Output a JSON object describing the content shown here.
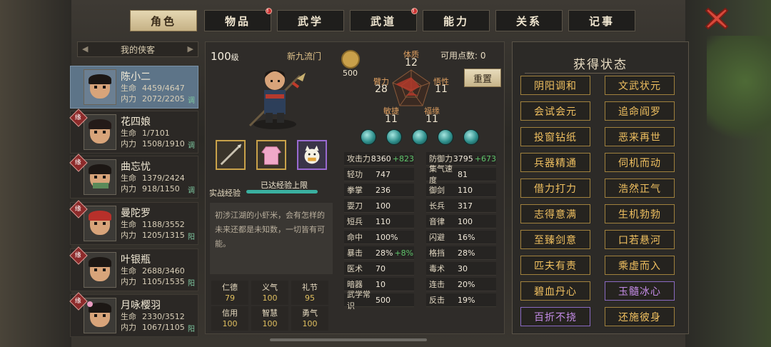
{
  "tabs": [
    {
      "label": "角色",
      "active": true,
      "dot": false
    },
    {
      "label": "物品",
      "active": false,
      "dot": true
    },
    {
      "label": "武学",
      "active": false,
      "dot": false
    },
    {
      "label": "武道",
      "active": false,
      "dot": true
    },
    {
      "label": "能力",
      "active": false,
      "dot": false
    },
    {
      "label": "关系",
      "active": false,
      "dot": false
    },
    {
      "label": "记事",
      "active": false,
      "dot": false
    }
  ],
  "list": {
    "title": "我的侠客"
  },
  "heroes": [
    {
      "name": "陈小二",
      "hp_label": "生命",
      "hp": "4459/4647",
      "mp_label": "内力",
      "mp": "2072/2205",
      "tag": "调",
      "badge": ""
    },
    {
      "name": "花四娘",
      "hp_label": "生命",
      "hp": "1/7101",
      "mp_label": "内力",
      "mp": "1508/1910",
      "tag": "调",
      "badge": "缘"
    },
    {
      "name": "曲忘忧",
      "hp_label": "生命",
      "hp": "1379/2424",
      "mp_label": "内力",
      "mp": "918/1150",
      "tag": "调",
      "badge": "缘"
    },
    {
      "name": "曼陀罗",
      "hp_label": "生命",
      "hp": "1188/3552",
      "mp_label": "内力",
      "mp": "1205/1315",
      "tag": "阳",
      "badge": "缘"
    },
    {
      "name": "叶银瓶",
      "hp_label": "生命",
      "hp": "2688/3460",
      "mp_label": "内力",
      "mp": "1105/1535",
      "tag": "阳",
      "badge": "缘"
    },
    {
      "name": "月咏樱羽",
      "hp_label": "生命",
      "hp": "2330/3512",
      "mp_label": "内力",
      "mp": "1067/1105",
      "tag": "阳",
      "badge": "缘"
    }
  ],
  "char": {
    "level": "100",
    "level_unit": "级",
    "sect": "新九流门",
    "xp_label": "实战经验",
    "xp_status": "已达经验上限",
    "xp_fraction": 1.0,
    "desc": "初涉江湖的小虾米，会有怎样的未来还都是未知数，一切皆有可能。",
    "virtues": [
      {
        "n": "仁德",
        "v": "79"
      },
      {
        "n": "义气",
        "v": "100"
      },
      {
        "n": "礼节",
        "v": "95"
      },
      {
        "n": "信用",
        "v": "100"
      },
      {
        "n": "智慧",
        "v": "100"
      },
      {
        "n": "勇气",
        "v": "100"
      }
    ],
    "energy": "500"
  },
  "attrs": {
    "tizhi": {
      "n": "体质",
      "v": "12"
    },
    "biili": {
      "n": "臂力",
      "v": "28"
    },
    "wuxing": {
      "n": "悟性",
      "v": "11"
    },
    "minjie": {
      "n": "敏捷",
      "v": "11"
    },
    "fuyuan": {
      "n": "福缘",
      "v": "11"
    },
    "points_label": "可用点数:",
    "points": "0",
    "reset": "重置"
  },
  "stats": [
    {
      "k": "攻击力",
      "v": "8360",
      "b": "+823"
    },
    {
      "k": "防御力",
      "v": "3795",
      "b": "+673"
    },
    {
      "k": "轻功",
      "v": "747",
      "b": ""
    },
    {
      "k": "集气速度",
      "v": "81",
      "b": ""
    },
    {
      "k": "拳掌",
      "v": "236",
      "b": ""
    },
    {
      "k": "御剑",
      "v": "110",
      "b": ""
    },
    {
      "k": "耍刀",
      "v": "100",
      "b": ""
    },
    {
      "k": "长兵",
      "v": "317",
      "b": ""
    },
    {
      "k": "短兵",
      "v": "110",
      "b": ""
    },
    {
      "k": "音律",
      "v": "100",
      "b": ""
    },
    {
      "k": "命中",
      "v": "100%",
      "b": ""
    },
    {
      "k": "闪避",
      "v": "16%",
      "b": ""
    },
    {
      "k": "暴击",
      "v": "28%",
      "b": "+8%"
    },
    {
      "k": "格挡",
      "v": "28%",
      "b": ""
    },
    {
      "k": "医术",
      "v": "70",
      "b": ""
    },
    {
      "k": "毒术",
      "v": "30",
      "b": ""
    },
    {
      "k": "暗器",
      "v": "10",
      "b": ""
    },
    {
      "k": "连击",
      "v": "20%",
      "b": ""
    },
    {
      "k": "武学常识",
      "v": "500",
      "b": ""
    },
    {
      "k": "反击",
      "v": "19%",
      "b": ""
    }
  ],
  "status": {
    "title": "获得状态",
    "items": [
      {
        "label": "阴阳调和",
        "purple": false
      },
      {
        "label": "文武状元",
        "purple": false
      },
      {
        "label": "会试会元",
        "purple": false
      },
      {
        "label": "追命阎罗",
        "purple": false
      },
      {
        "label": "投窗钻纸",
        "purple": false
      },
      {
        "label": "恶来再世",
        "purple": false
      },
      {
        "label": "兵器精通",
        "purple": false
      },
      {
        "label": "伺机而动",
        "purple": false
      },
      {
        "label": "借力打力",
        "purple": false
      },
      {
        "label": "浩然正气",
        "purple": false
      },
      {
        "label": "志得意满",
        "purple": false
      },
      {
        "label": "生机勃勃",
        "purple": false
      },
      {
        "label": "至臻剑意",
        "purple": false
      },
      {
        "label": "口若悬河",
        "purple": false
      },
      {
        "label": "匹夫有责",
        "purple": false
      },
      {
        "label": "乘虚而入",
        "purple": false
      },
      {
        "label": "碧血丹心",
        "purple": false
      },
      {
        "label": "玉髓冰心",
        "purple": true
      },
      {
        "label": "百折不挠",
        "purple": true
      },
      {
        "label": "还施彼身",
        "purple": false
      }
    ]
  }
}
